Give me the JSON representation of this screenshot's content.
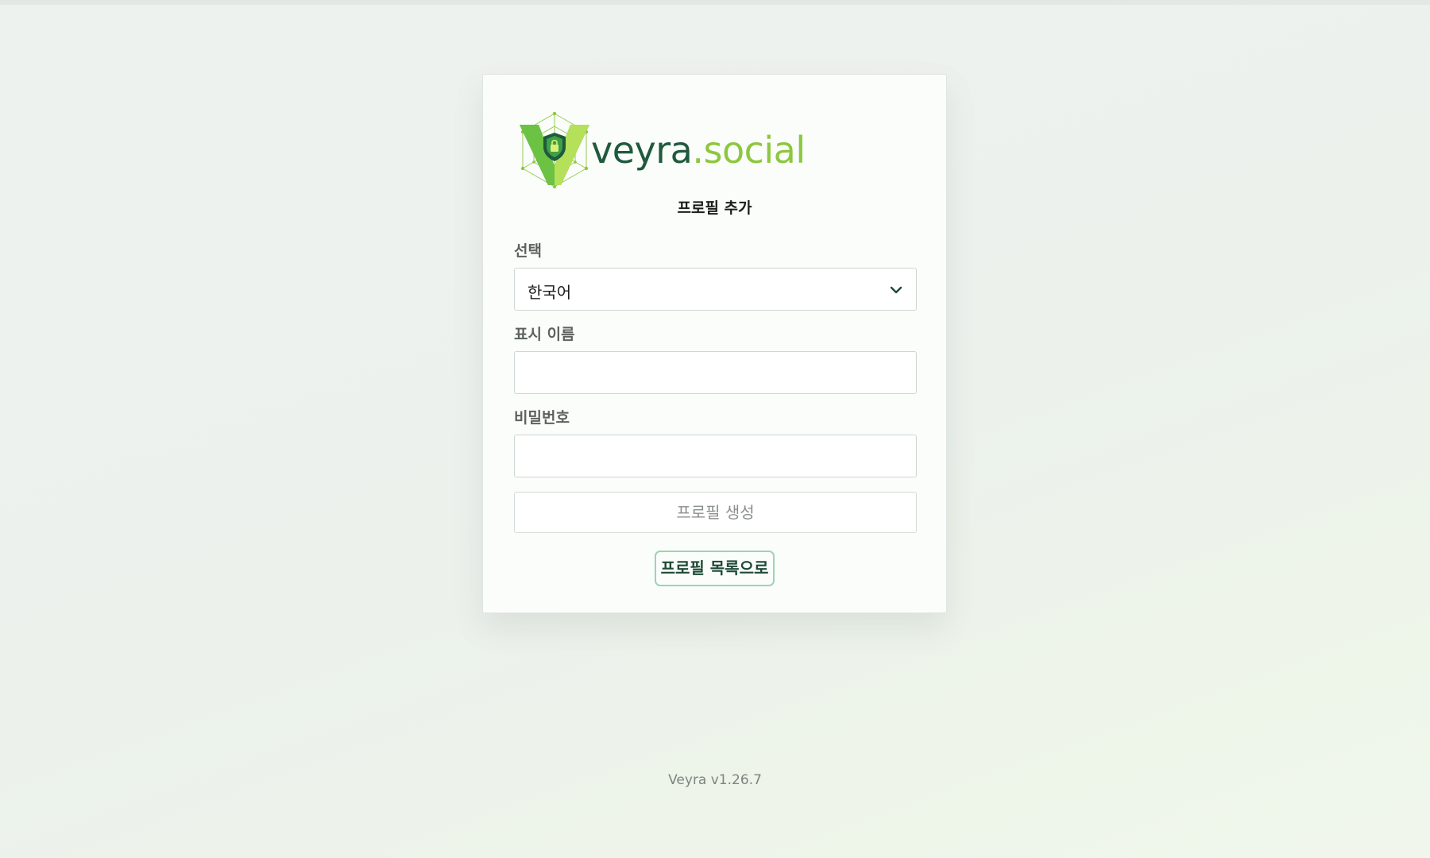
{
  "brand": {
    "name_part1": "veyra",
    "name_part2": ".social",
    "colors": {
      "dark_green": "#1f5a3c",
      "light_green": "#8dc73f"
    }
  },
  "form": {
    "title": "프로필 추가",
    "language": {
      "label": "선택",
      "selected": "한국어"
    },
    "display_name": {
      "label": "표시 이름",
      "value": ""
    },
    "password": {
      "label": "비밀번호",
      "value": ""
    },
    "create_button": "프로필 생성",
    "back_button": "프로필 목록으로"
  },
  "footer": {
    "version": "Veyra v1.26.7"
  },
  "icons": {
    "logo": "veyra-shield-logo-icon",
    "dropdown": "chevron-down-icon"
  }
}
